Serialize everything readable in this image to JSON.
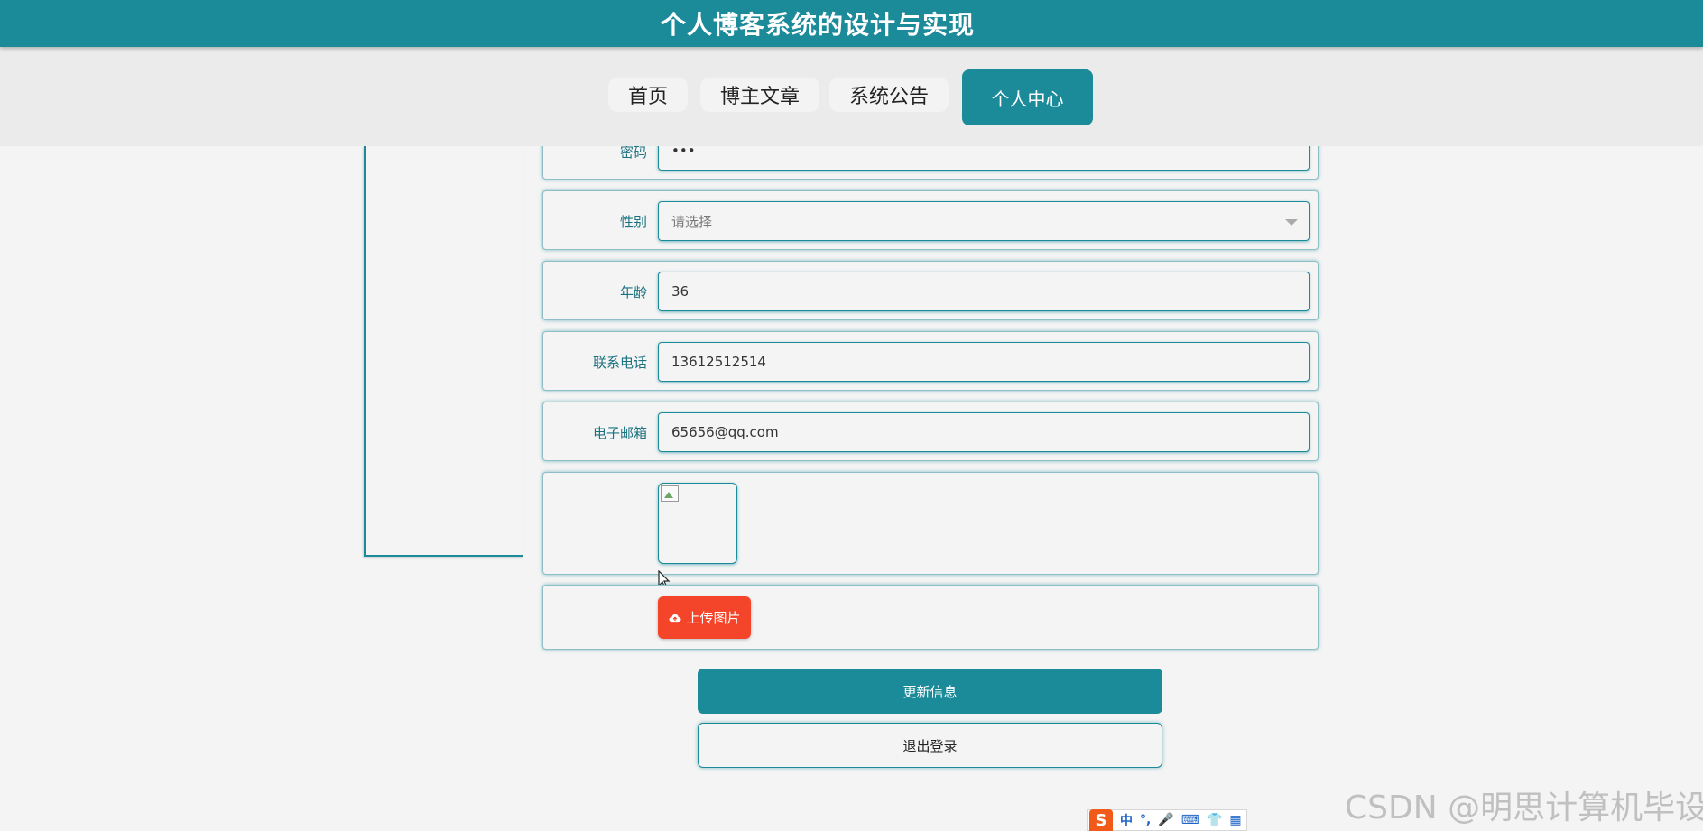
{
  "header": {
    "title": "个人博客系统的设计与实现"
  },
  "nav": {
    "items": [
      {
        "label": "首页"
      },
      {
        "label": "博主文章"
      },
      {
        "label": "系统公告"
      },
      {
        "label": "个人中心"
      }
    ],
    "active": "个人中心"
  },
  "form": {
    "password": {
      "label": "密码",
      "value": "•••"
    },
    "gender": {
      "label": "性别",
      "placeholder": "请选择"
    },
    "age": {
      "label": "年龄",
      "value": "36"
    },
    "phone": {
      "label": "联系电话",
      "value": "13612512514"
    },
    "email": {
      "label": "电子邮箱",
      "value": "65656@qq.com"
    }
  },
  "upload_label": "上传图片",
  "update_label": "更新信息",
  "logout_label": "退出登录",
  "watermark": "CSDN @明思计算机毕设",
  "ime": {
    "logo": "S",
    "items": [
      "中",
      "°,",
      "🎤",
      "⌨",
      "👕",
      "▦"
    ]
  },
  "colors": {
    "primary": "#1b8a99",
    "upload": "#f4442a",
    "background": "#f4f4f4"
  }
}
